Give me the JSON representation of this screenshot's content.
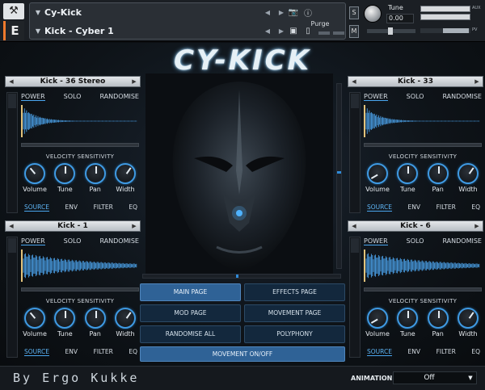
{
  "host": {
    "instrument_name": "Cy-Kick",
    "snapshot_name": "Kick - Cyber 1",
    "purge_label": "Purge",
    "tune_label": "Tune",
    "tune_value": "0.00",
    "s_label": "S",
    "m_label": "M",
    "aux_label": "AUX",
    "pv_label": "PV",
    "kontakt_logo": "E"
  },
  "logo": "CY-KICK",
  "panels": [
    {
      "title": "Kick - 36 Stereo",
      "tabs": [
        "POWER",
        "SOLO",
        "RANDOMISE"
      ],
      "velocity_label": "VELOCITY SENSITIVITY",
      "knobs": [
        {
          "label": "Volume",
          "angle": -40
        },
        {
          "label": "Tune",
          "angle": 0
        },
        {
          "label": "Pan",
          "angle": 0
        },
        {
          "label": "Width",
          "angle": 35
        }
      ],
      "bottom_tabs": [
        "SOURCE",
        "ENV",
        "FILTER",
        "EQ"
      ],
      "wave": "short"
    },
    {
      "title": "Kick - 33",
      "tabs": [
        "POWER",
        "SOLO",
        "RANDOMISE"
      ],
      "velocity_label": "VELOCITY SENSITIVITY",
      "knobs": [
        {
          "label": "Volume",
          "angle": -120
        },
        {
          "label": "Tune",
          "angle": 0
        },
        {
          "label": "Pan",
          "angle": 0
        },
        {
          "label": "Width",
          "angle": 35
        }
      ],
      "bottom_tabs": [
        "SOURCE",
        "ENV",
        "FILTER",
        "EQ"
      ],
      "wave": "short"
    },
    {
      "title": "Kick - 1",
      "tabs": [
        "POWER",
        "SOLO",
        "RANDOMISE"
      ],
      "velocity_label": "VELOCITY SENSITIVITY",
      "knobs": [
        {
          "label": "Volume",
          "angle": -40
        },
        {
          "label": "Tune",
          "angle": 0
        },
        {
          "label": "Pan",
          "angle": 0
        },
        {
          "label": "Width",
          "angle": 35
        }
      ],
      "bottom_tabs": [
        "SOURCE",
        "ENV",
        "FILTER",
        "EQ"
      ],
      "wave": "long"
    },
    {
      "title": "Kick - 6",
      "tabs": [
        "POWER",
        "SOLO",
        "RANDOMISE"
      ],
      "velocity_label": "VELOCITY SENSITIVITY",
      "knobs": [
        {
          "label": "Volume",
          "angle": -120
        },
        {
          "label": "Tune",
          "angle": 0
        },
        {
          "label": "Pan",
          "angle": 0
        },
        {
          "label": "Width",
          "angle": 35
        }
      ],
      "bottom_tabs": [
        "SOURCE",
        "ENV",
        "FILTER",
        "EQ"
      ],
      "wave": "long"
    }
  ],
  "center_buttons": {
    "main_page": "MAIN PAGE",
    "effects_page": "EFFECTS PAGE",
    "mod_page": "MOD PAGE",
    "movement_page": "MOVEMENT PAGE",
    "randomise_all": "RANDOMISE ALL",
    "polyphony": "POLYPHONY",
    "movement_onoff": "MOVEMENT ON/OFF"
  },
  "footer": {
    "credit": "By Ergo Kukke",
    "animation_label": "ANIMATION",
    "animation_value": "Off"
  },
  "colors": {
    "accent": "#3f9ae3",
    "active_button": "#2f6296",
    "wave": "#4a9fe6"
  }
}
